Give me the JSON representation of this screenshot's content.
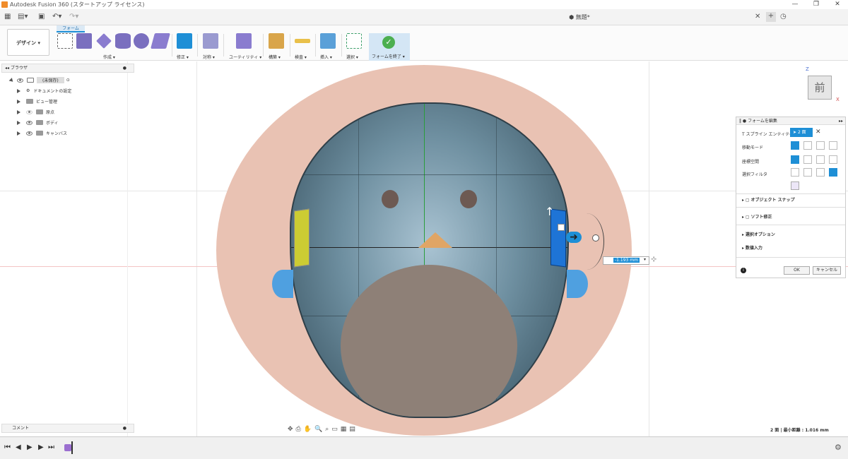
{
  "window": {
    "title": "Autodesk Fusion 360 (スタートアップ ライセンス)",
    "doc_title": "無題*"
  },
  "toolbar": {
    "workspace": "デザイン ▾",
    "active_tab": "フォーム",
    "groups": [
      "作成 ▾",
      "修正 ▾",
      "対称 ▾",
      "ユーティリティ ▾",
      "構築 ▾",
      "検査 ▾",
      "挿入 ▾",
      "選択 ▾",
      "フォームを終了 ▾"
    ]
  },
  "browser": {
    "title": "ブラウザ",
    "items": [
      {
        "label": "(未保存)"
      },
      {
        "label": "ドキュメントの設定"
      },
      {
        "label": "ビュー管理"
      },
      {
        "label": "原点"
      },
      {
        "label": "ボディ"
      },
      {
        "label": "キャンバス"
      }
    ]
  },
  "comment": {
    "label": "コメント"
  },
  "viewcube": {
    "face": "前",
    "z": "Z",
    "x": "X"
  },
  "dimension": {
    "value": "-1.193 mm"
  },
  "edit_form": {
    "title": "フォームを編集",
    "tspline_label": "T スプライン エンティティ",
    "face_count": "2 面",
    "move_mode": "移動モード",
    "coord_space": "座標空間",
    "select_filter": "選択フィルタ",
    "object_snap": "オブジェクト スナップ",
    "soft_modify": "ソフト修正",
    "select_options": "選択オプション",
    "numeric_input": "数値入力",
    "ok": "OK",
    "cancel": "キャンセル"
  },
  "status": {
    "text": "2 面 | 最小距離 : 1.016 mm"
  },
  "colors": {
    "accent": "#1e8fd6",
    "finish": "#4caf50",
    "highlight_yellow": "#cccc33"
  }
}
